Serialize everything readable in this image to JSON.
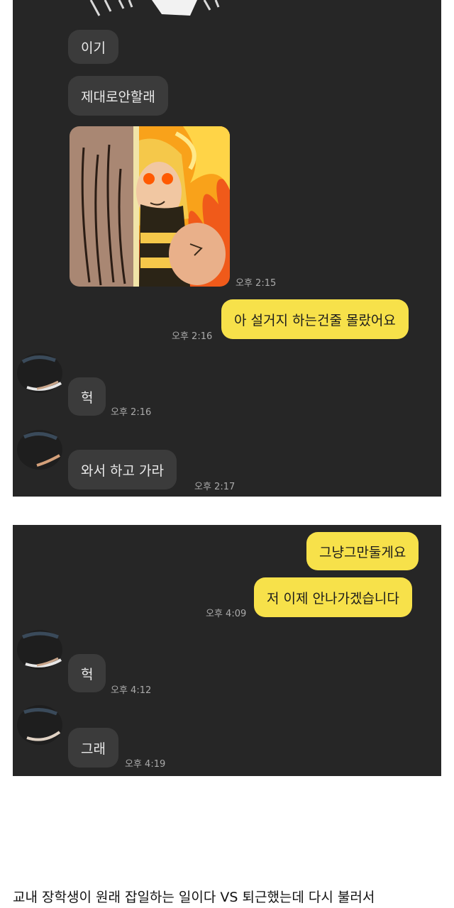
{
  "chat1": {
    "messages": [
      {
        "text": "이기"
      },
      {
        "text": "제대로안할래"
      },
      {
        "time": "오후 2:15"
      },
      {
        "text": "아 설거지 하는건줄 몰랐어요",
        "time": "오후 2:16"
      },
      {
        "text": "헉",
        "time": "오후 2:16"
      },
      {
        "text": "와서 하고 가라",
        "time": "오후 2:17"
      }
    ],
    "sticker_icon": "angry-bee-character-sticker"
  },
  "chat2": {
    "messages": [
      {
        "text": "그냥그만둘게요"
      },
      {
        "text": "저 이제 안나가겠습니다",
        "time": "오후 4:09"
      },
      {
        "text": "헉",
        "time": "오후 4:12"
      },
      {
        "text": "그래",
        "time": "오후 4:19"
      }
    ]
  },
  "caption": "교내 장학생이 원래 잡일하는 일이다 VS 퇴근했는데 다시 불러서",
  "colors": {
    "chat_bg": "#262626",
    "incoming_bubble": "#3b3b3b",
    "outgoing_bubble": "#f7e14a"
  }
}
